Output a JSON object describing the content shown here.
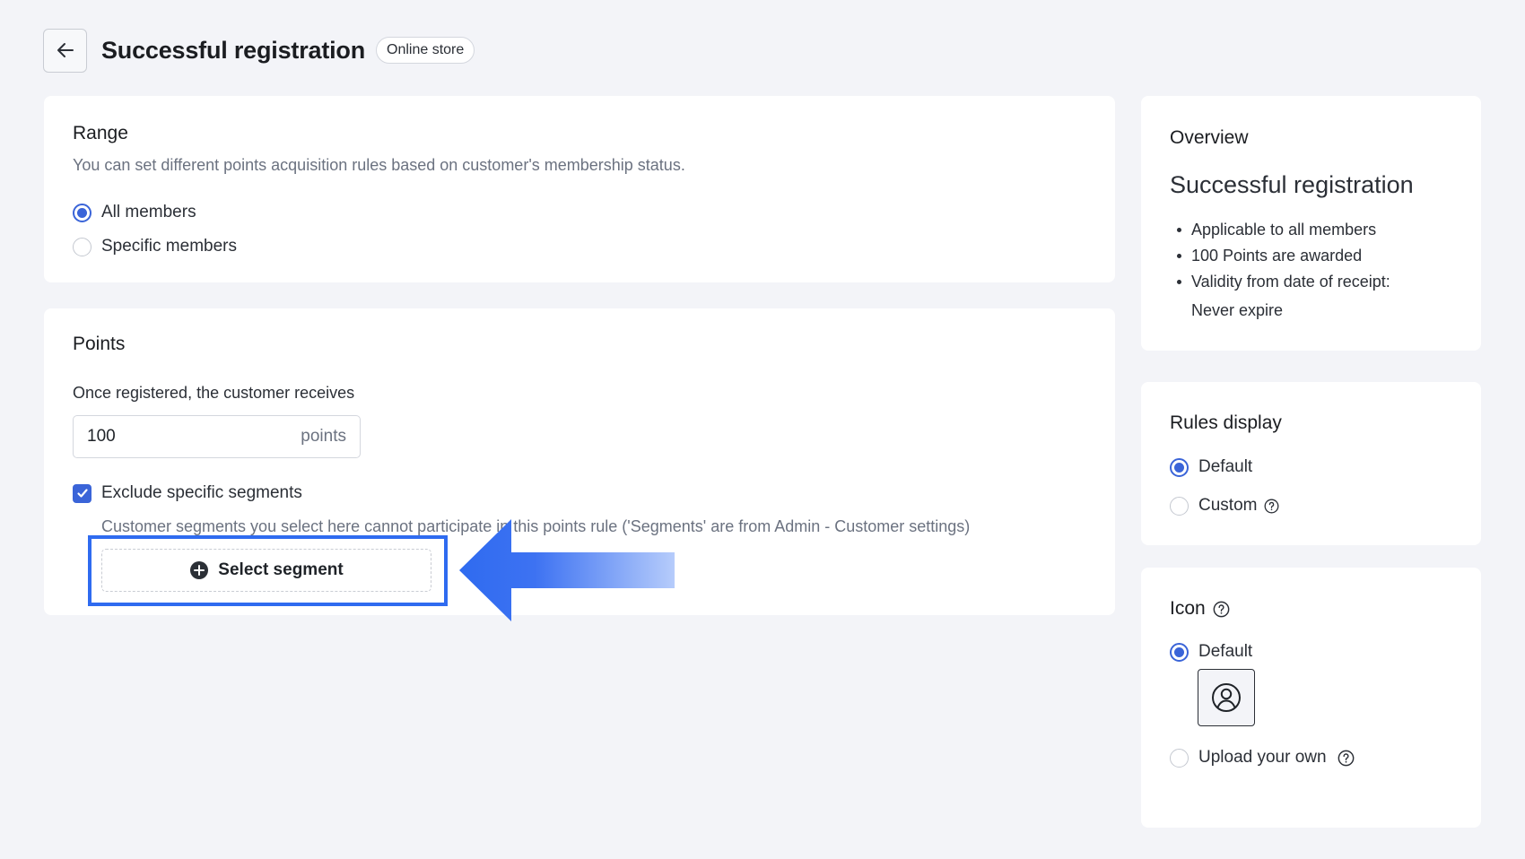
{
  "header": {
    "title": "Successful registration",
    "badge": "Online store"
  },
  "range": {
    "title": "Range",
    "description": "You can set different points acquisition rules based on customer's membership status.",
    "options": [
      {
        "label": "All members",
        "selected": true
      },
      {
        "label": "Specific members",
        "selected": false
      }
    ]
  },
  "points": {
    "title": "Points",
    "prompt": "Once registered, the customer receives",
    "value": "100",
    "unit": "points",
    "exclude": {
      "label": "Exclude specific segments",
      "checked": true,
      "help": "Customer segments you select here cannot participate in this points rule ('Segments' are from Admin - Customer settings)"
    },
    "select_segment_label": "Select segment"
  },
  "overview": {
    "heading": "Overview",
    "title": "Successful registration",
    "items": [
      "Applicable to all members",
      "100 Points are awarded",
      "Validity from date of receipt:",
      "Never expire"
    ]
  },
  "rules_display": {
    "title": "Rules display",
    "options": [
      {
        "label": "Default",
        "selected": true
      },
      {
        "label": "Custom",
        "selected": false
      }
    ]
  },
  "icon_section": {
    "title": "Icon",
    "options": [
      {
        "label": "Default",
        "selected": true
      },
      {
        "label": "Upload your own",
        "selected": false
      }
    ]
  },
  "colors": {
    "accent": "#3a64d8",
    "highlight": "#2f6bf0",
    "background": "#f3f4f8"
  }
}
